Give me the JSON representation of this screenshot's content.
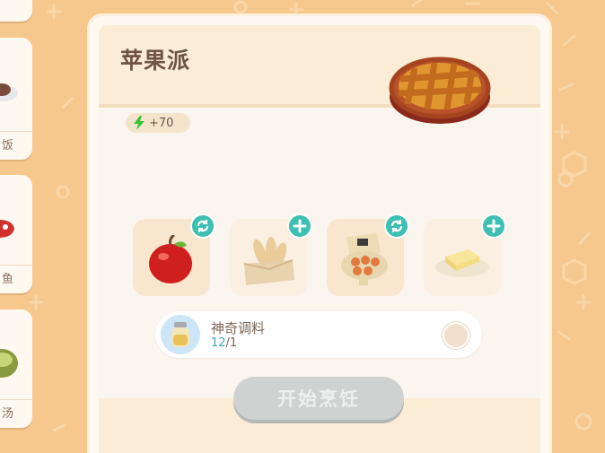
{
  "sidebar": {
    "items": [
      {
        "label": "",
        "icon": "bowl-icon"
      },
      {
        "label": "饭",
        "icon": "plate-icon"
      },
      {
        "label": "鱼",
        "icon": "fish-icon"
      },
      {
        "label": "汤",
        "icon": "soup-icon"
      }
    ]
  },
  "recipe": {
    "title": "苹果派",
    "energy": "+70",
    "dish_icon": "apple-pie-icon"
  },
  "ingredients": [
    {
      "icon": "apple-icon",
      "action": "swap-icon"
    },
    {
      "icon": "bread-crate-icon",
      "action": "add-icon"
    },
    {
      "icon": "egg-carton-icon",
      "action": "swap-icon"
    },
    {
      "icon": "butter-icon",
      "action": "add-icon"
    }
  ],
  "seasoning": {
    "name": "神奇调料",
    "current": "12",
    "required": "/1",
    "icon": "magic-jar-icon"
  },
  "cook_button": {
    "label": "开始烹饪",
    "state": "disabled"
  },
  "colors": {
    "background": "#f6c88e",
    "accent": "#3dbfb1",
    "energy": "#36c43a",
    "button_disabled": "#cfd2d1"
  }
}
